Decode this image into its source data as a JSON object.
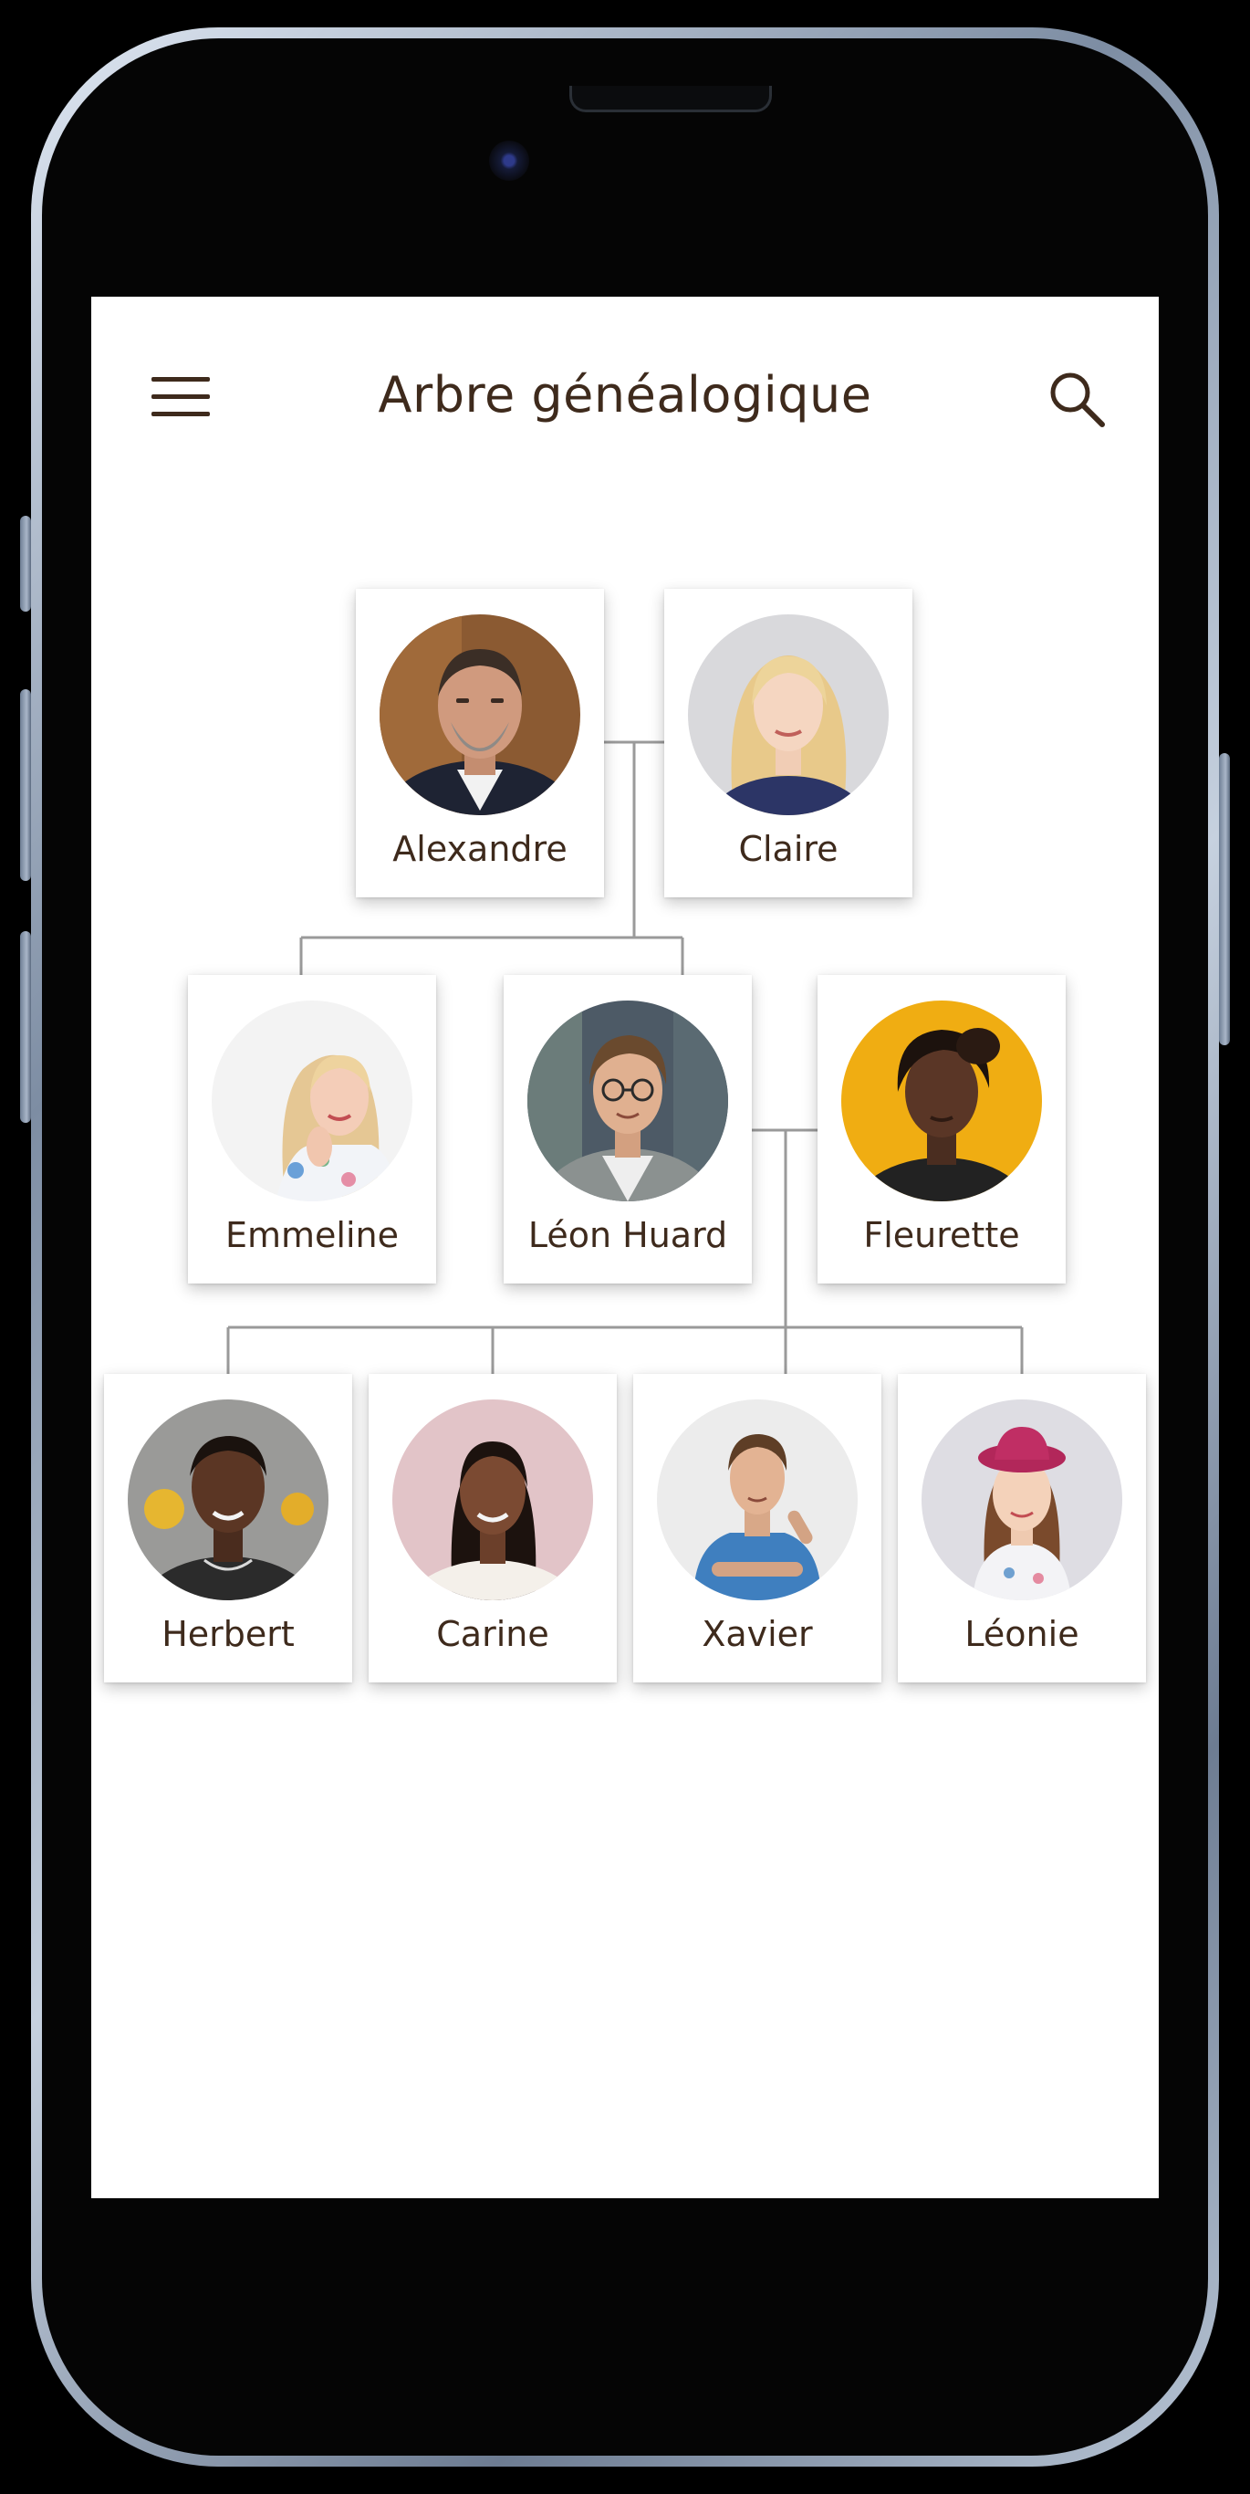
{
  "app": {
    "title": "Arbre généalogique",
    "menu_icon": "hamburger-menu-icon",
    "search_icon": "search-icon"
  },
  "colors": {
    "title_text": "#3e2a1c",
    "connector": "#9a9a9a",
    "card_background": "#ffffff"
  },
  "tree": {
    "generation_1": [
      {
        "name": "Alexandre"
      },
      {
        "name": "Claire"
      }
    ],
    "generation_2": [
      {
        "name": "Emmeline"
      },
      {
        "name": "Léon Huard"
      },
      {
        "name": "Fleurette"
      }
    ],
    "generation_3": [
      {
        "name": "Herbert"
      },
      {
        "name": "Carine"
      },
      {
        "name": "Xavier"
      },
      {
        "name": "Léonie"
      }
    ]
  }
}
